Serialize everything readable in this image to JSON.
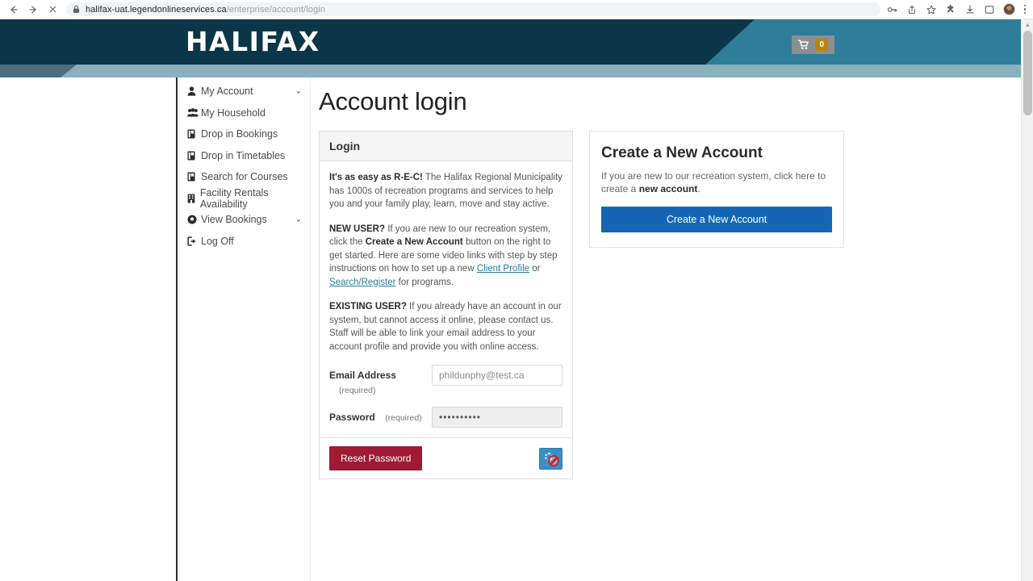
{
  "browser": {
    "back_icon": "back-arrow-icon",
    "forward_icon": "forward-arrow-icon",
    "stop_icon": "stop-loading-icon",
    "lock_icon": "lock-icon",
    "url_host": "halifax-uat.legendonlineservices.ca",
    "url_path": "/enterprise/account/login",
    "toolbar_icons": [
      "key-icon",
      "share-icon",
      "star-icon",
      "extensions-icon",
      "download-icon",
      "sidepanel-icon",
      "profile-avatar",
      "menu-kebab-icon"
    ]
  },
  "header": {
    "logo": "HALIFAX",
    "cart_icon": "shopping-cart-icon",
    "cart_count": "0"
  },
  "sidebar": {
    "items": [
      {
        "label": "My Account",
        "icon": "user-icon",
        "chevron": "chevron-down-icon"
      },
      {
        "label": "My Household",
        "icon": "users-group-icon",
        "chevron": ""
      },
      {
        "label": "Drop in Bookings",
        "icon": "book-icon",
        "chevron": ""
      },
      {
        "label": "Drop in Timetables",
        "icon": "book-icon",
        "chevron": ""
      },
      {
        "label": "Search for Courses",
        "icon": "book-icon",
        "chevron": ""
      },
      {
        "label": "Facility Rentals Availability",
        "icon": "building-icon",
        "chevron": ""
      },
      {
        "label": "View Bookings",
        "icon": "soccer-ball-icon",
        "chevron": "chevron-down-icon"
      },
      {
        "label": "Log Off",
        "icon": "logout-icon",
        "chevron": ""
      }
    ]
  },
  "main": {
    "page_title": "Account login",
    "login_panel": {
      "heading": "Login",
      "intro_bold": "It's as easy as R-E-C!",
      "intro_rest": " The Halifax Regional Municipality has 1000s of recreation programs and services to help you and your family play, learn, move and stay active.",
      "new_user_label": "NEW USER?",
      "new_user_p1": " If you are new to our recreation system, click the ",
      "new_user_bold": "Create a New Account",
      "new_user_p2": " button on the right to get started. Here are some video links with step by step instructions on how to set up a new ",
      "link_client_profile": "Client Profile",
      "new_user_p3": " or ",
      "link_search_register": "Search/Register",
      "new_user_p4": " for programs.",
      "existing_user_label": "EXISTING USER?",
      "existing_user_text": " If you already have an account in our system, but cannot access it online, please contact us. Staff will be able to link your email address to your account profile and provide you with online access.",
      "email_label": "Email Address",
      "email_required": "(required)",
      "email_value": "phildunphy@test.ca",
      "password_label": "Password",
      "password_required": "(required)",
      "password_value": "••••••••••",
      "reset_button": "Reset Password",
      "login_button_state": "loading-disabled",
      "login_button_icon": "spinner-blocked-icon"
    },
    "create_panel": {
      "title": "Create a New Account",
      "text_part1": "If you are new to our recreation system, click here to create a ",
      "text_bold": "new account",
      "text_part2": ".",
      "button": "Create a New Account"
    }
  },
  "scrollbar": {
    "up_arrow_icon": "scroll-up-arrow-icon"
  },
  "colors": {
    "header_dark": "#0b3649",
    "header_teal": "#2e7d9a",
    "strip": "#8aafbd",
    "primary_button": "#1565b5",
    "reset_button": "#9e1b32",
    "badge": "#b8860b",
    "link": "#2b7d99"
  }
}
